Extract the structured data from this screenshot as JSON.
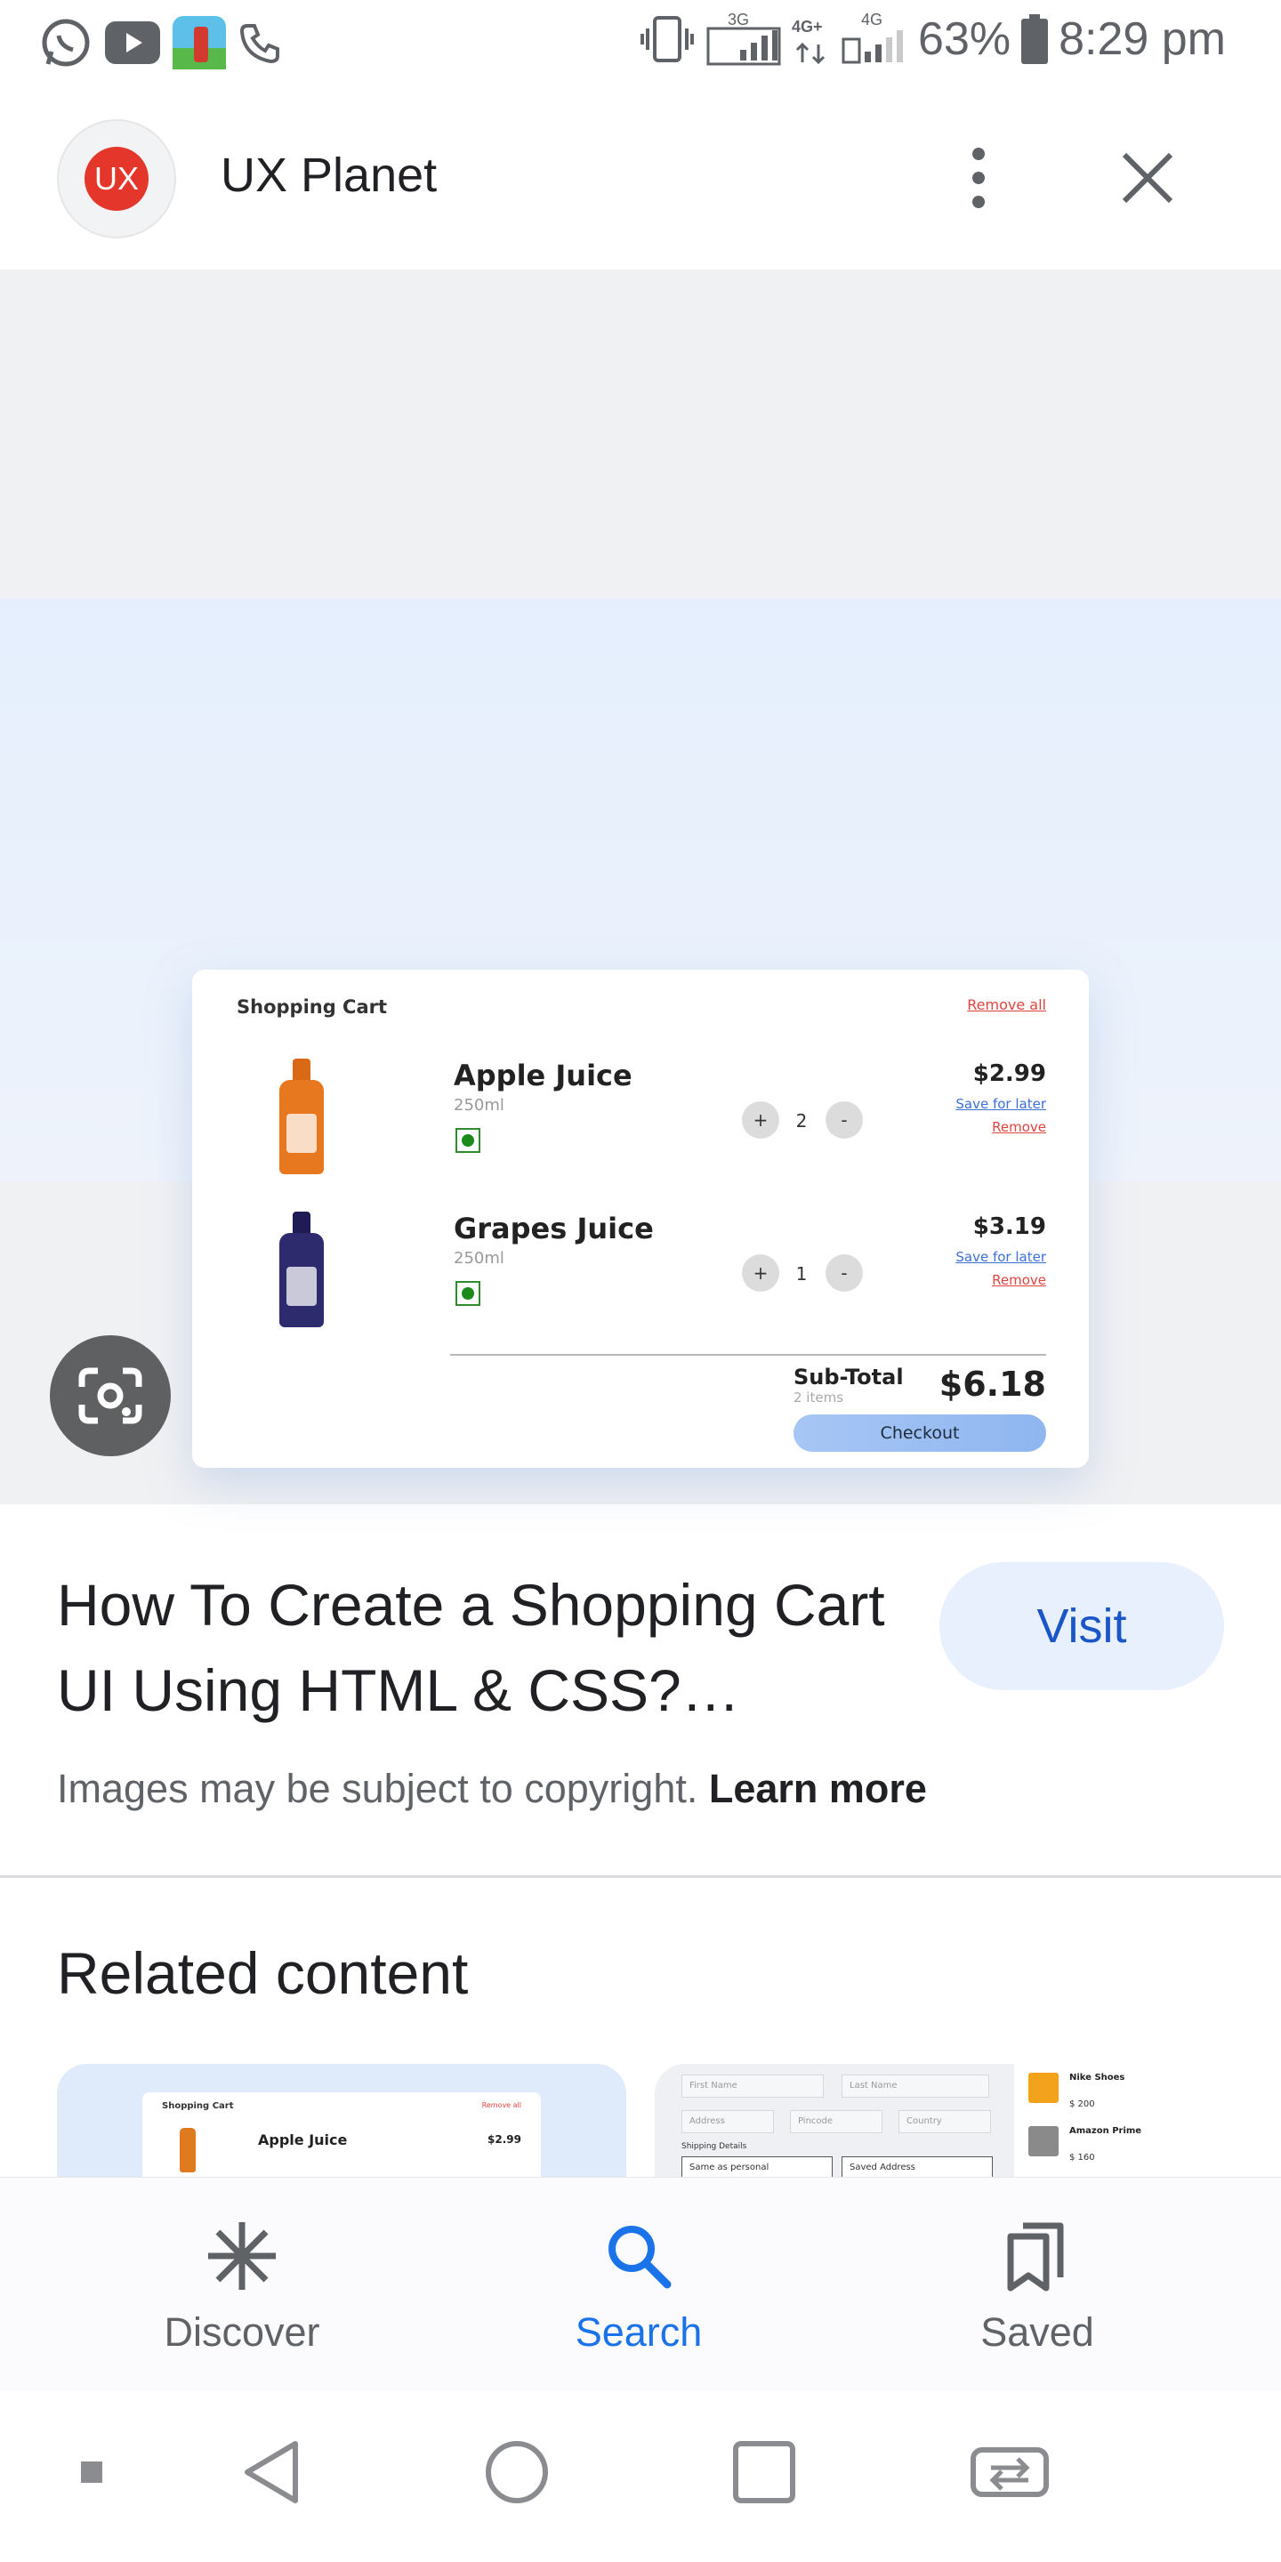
{
  "status_bar": {
    "left_icons": [
      "whatsapp-icon",
      "youtube-icon",
      "game-app-icon",
      "phone-icon"
    ],
    "network_3g": "3G",
    "network_4g_plus": "4G+",
    "network_4g": "4G",
    "battery": "63%",
    "time": "8:29 pm"
  },
  "header": {
    "logo_text": "UX",
    "site_name": "UX Planet"
  },
  "image": {
    "cart": {
      "title": "Shopping Cart",
      "remove_all": "Remove all",
      "items": [
        {
          "name": "Apple Juice",
          "volume": "250ml",
          "quantity": "2",
          "price": "$2.99",
          "save_for_later": "Save for later",
          "remove": "Remove",
          "color": "#e8781f"
        },
        {
          "name": "Grapes Juice",
          "volume": "250ml",
          "quantity": "1",
          "price": "$3.19",
          "save_for_later": "Save for later",
          "remove": "Remove",
          "color": "#2d2a6e"
        }
      ],
      "plus_label": "+",
      "minus_label": "-",
      "subtotal_label": "Sub-Total",
      "subtotal_items": "2 items",
      "subtotal_value": "$6.18",
      "checkout": "Checkout"
    }
  },
  "result": {
    "title": "How To Create a Shopping Cart UI Using HTML & CSS?…",
    "visit": "Visit",
    "copyright": "Images may be subject to copyright.",
    "learn_more": "Learn more"
  },
  "related": {
    "title": "Related content",
    "thumb1": {
      "cart_title": "Shopping Cart",
      "remove_all": "Remove all",
      "item_name": "Apple Juice",
      "item_price": "$2.99"
    },
    "thumb2": {
      "fields": [
        "First Name",
        "Last Name",
        "Address",
        "Pincode",
        "Country"
      ],
      "shipping_details": "Shipping Details",
      "same_as_personal": "Same as personal",
      "saved_address": "Saved Address",
      "products": [
        {
          "name": "Nike Shoes",
          "price": "$ 200"
        },
        {
          "name": "Amazon Prime",
          "price": "$ 160"
        }
      ]
    }
  },
  "bottom_nav": {
    "items": [
      {
        "label": "Discover",
        "icon": "asterisk-icon"
      },
      {
        "label": "Search",
        "icon": "search-icon",
        "active": true
      },
      {
        "label": "Saved",
        "icon": "bookmarks-icon"
      }
    ]
  },
  "colors": {
    "accent": "#1a73e8",
    "visit_bg": "#e8f0fe",
    "logo_red": "#e4362a"
  }
}
